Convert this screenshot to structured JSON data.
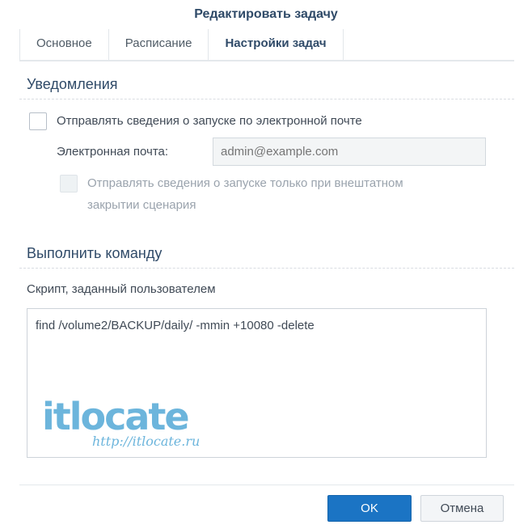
{
  "dialog": {
    "title": "Редактировать задачу",
    "tabs": [
      {
        "label": "Основное",
        "active": false
      },
      {
        "label": "Расписание",
        "active": false
      },
      {
        "label": "Настройки задач",
        "active": true
      }
    ]
  },
  "notifications": {
    "heading": "Уведомления",
    "send_email_label": "Отправлять сведения о запуске по электронной почте",
    "send_email_checked": false,
    "email_label": "Электронная почта:",
    "email_placeholder": "admin@example.com",
    "only_abnormal_label_line1": "Отправлять сведения о запуске только при внештатном",
    "only_abnormal_label_line2": "закрытии сценария",
    "only_abnormal_checked": false
  },
  "run_command": {
    "heading": "Выполнить команду",
    "script_label": "Скрипт, заданный пользователем",
    "script_value": "find /volume2/BACKUP/daily/ -mmin +10080 -delete"
  },
  "watermark": {
    "logo_text": "itlocate",
    "url": "http://itlocate.ru"
  },
  "footer": {
    "ok_label": "OK",
    "cancel_label": "Отмена"
  },
  "colors": {
    "title": "#2f4a68",
    "ok_button": "#1b74c4",
    "watermark": "#6cb5dc"
  }
}
